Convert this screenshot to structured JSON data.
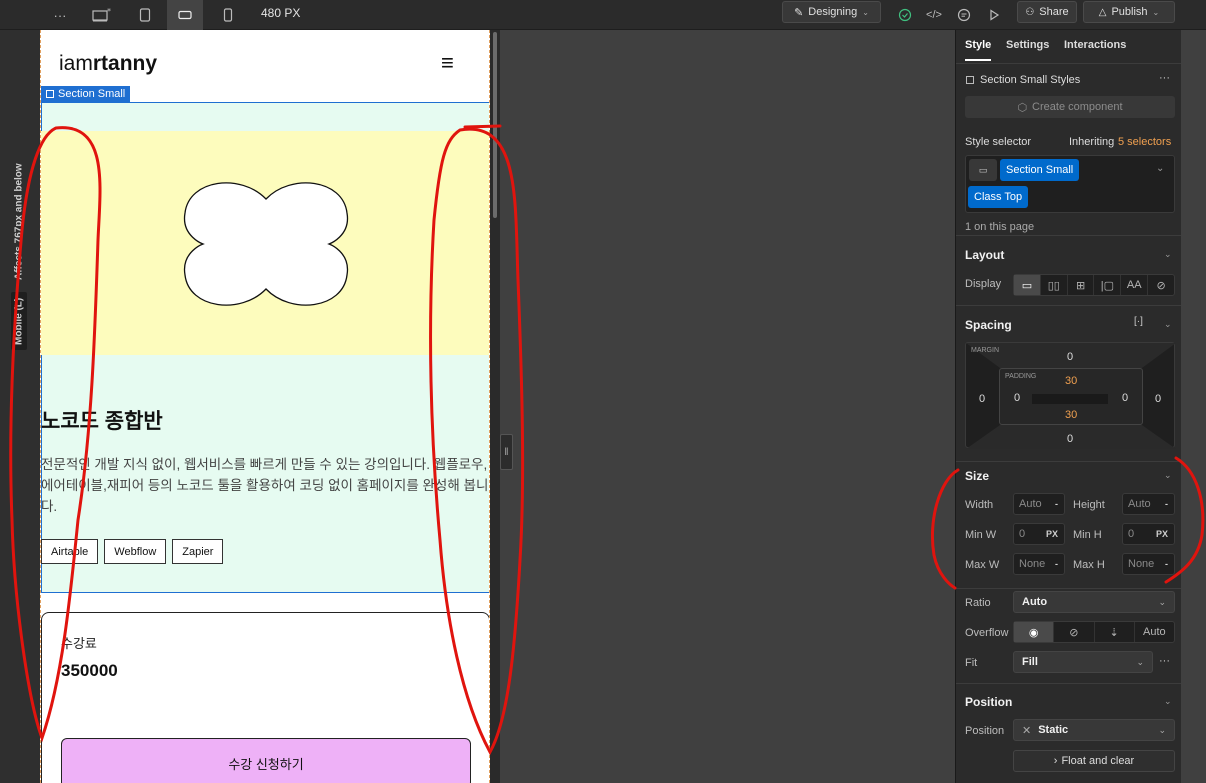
{
  "topbar": {
    "more": "···",
    "breakpoint_width": "480 PX",
    "mode": "Designing",
    "share": "Share",
    "publish": "Publish"
  },
  "left": {
    "affects": "Affects 767px and below",
    "mobile": "Mobile (L)"
  },
  "canvas": {
    "logo_light": "iam",
    "logo_bold": "rtanny",
    "menu_glyph": "≡",
    "selection_label": "Section Small",
    "course_title": "노코드 종합반",
    "course_desc": "전문적인 개발 지식 없이, 웹서비스를 빠르게 만들 수 있는 강의입니다. 웹플로우,에어테이블,재피어 등의 노코드 툴을 활용하여 코딩 없이 홈페이지를 완성해 봅니다.",
    "tags": [
      "Airtable",
      "Webflow",
      "Zapier"
    ],
    "fee_label": "수강료",
    "fee_value": "350000",
    "cta": "수강 신청하기",
    "colors": {
      "section_bg": "#e6fbf1",
      "image_bg": "#fdfcbd",
      "cta_bg": "#eeb1f7",
      "selection": "#1f6fd1"
    }
  },
  "panel": {
    "tabs": [
      "Style",
      "Settings",
      "Interactions"
    ],
    "style_name": "Section Small Styles",
    "more": "···",
    "create_component": "Create component",
    "style_selector": "Style selector",
    "inheriting_prefix": "Inheriting",
    "inheriting_count": "5 selectors",
    "selector_tags": [
      "Section Small",
      "Class Top"
    ],
    "on_page": "1 on this page",
    "layout": {
      "title": "Layout",
      "display": "Display",
      "display_opts": [
        "▭",
        "▯▯",
        "⊞",
        "|▢",
        "AA",
        "⊘"
      ]
    },
    "spacing": {
      "title": "Spacing",
      "margin_label": "MARGIN",
      "padding_label": "PADDING",
      "margin": {
        "top": "0",
        "right": "0",
        "bottom": "0",
        "left": "0"
      },
      "padding": {
        "top": "30",
        "right": "0",
        "bottom": "30",
        "left": "0"
      }
    },
    "size": {
      "title": "Size",
      "width": "Width",
      "width_val": "Auto",
      "height": "Height",
      "height_val": "Auto",
      "min_w": "Min W",
      "min_w_val": "0",
      "min_w_unit": "PX",
      "min_h": "Min H",
      "min_h_val": "0",
      "min_h_unit": "PX",
      "max_w": "Max W",
      "max_w_val": "None",
      "max_h": "Max H",
      "max_h_val": "None",
      "unit_dash": "-",
      "ratio": "Ratio",
      "ratio_val": "Auto",
      "overflow": "Overflow",
      "overflow_auto": "Auto",
      "fit": "Fit",
      "fit_val": "Fill"
    },
    "position": {
      "title": "Position",
      "label": "Position",
      "value": "Static",
      "float": "Float and clear"
    }
  }
}
